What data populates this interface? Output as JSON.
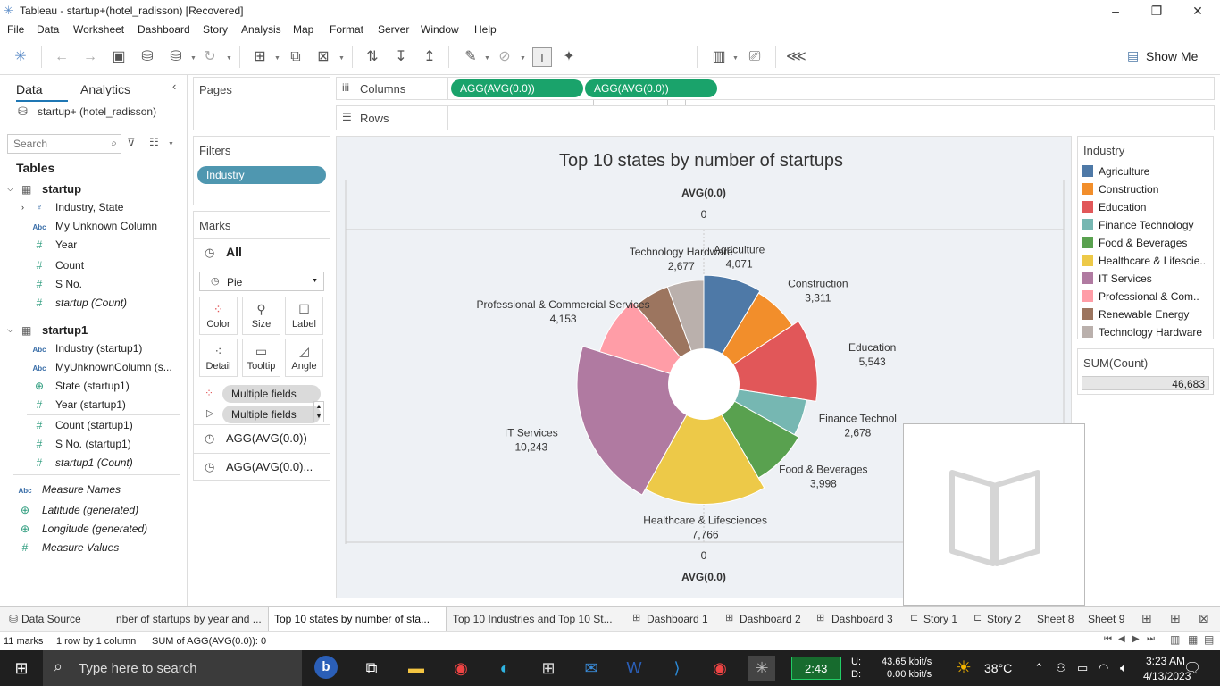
{
  "window": {
    "title": "Tableau - startup+(hotel_radisson) [Recovered]",
    "minimize": "–",
    "restore": "❐",
    "close": "✕"
  },
  "menu": [
    "File",
    "Data",
    "Worksheet",
    "Dashboard",
    "Story",
    "Analysis",
    "Map",
    "Format",
    "Server",
    "Window",
    "Help"
  ],
  "toolbar": {
    "view_mode": "Entire View",
    "show_me": "Show Me"
  },
  "data_pane": {
    "tab_data": "Data",
    "tab_analytics": "Analytics",
    "datasource": "startup+ (hotel_radisson)",
    "search_placeholder": "Search",
    "tables_label": "Tables",
    "table1": {
      "name": "startup",
      "fields": [
        {
          "type": "hier",
          "label": "Industry, State"
        },
        {
          "type": "abc",
          "label": "My Unknown Column"
        },
        {
          "type": "hash",
          "label": "Year"
        },
        {
          "type": "hash",
          "label": "Count"
        },
        {
          "type": "hash",
          "label": "S No."
        },
        {
          "type": "hash",
          "label": "startup (Count)"
        }
      ]
    },
    "table2": {
      "name": "startup1",
      "fields": [
        {
          "type": "abc",
          "label": "Industry (startup1)"
        },
        {
          "type": "abc",
          "label": "MyUnknownColumn (s..."
        },
        {
          "type": "globe",
          "label": "State (startup1)"
        },
        {
          "type": "hash",
          "label": "Year (startup1)"
        },
        {
          "type": "hash",
          "label": "Count (startup1)"
        },
        {
          "type": "hash",
          "label": "S No. (startup1)"
        },
        {
          "type": "hash",
          "label": "startup1 (Count)"
        }
      ]
    },
    "extra_fields": [
      {
        "type": "abc",
        "label": "Measure Names"
      },
      {
        "type": "globe",
        "label": "Latitude (generated)"
      },
      {
        "type": "globe",
        "label": "Longitude (generated)"
      },
      {
        "type": "hash",
        "label": "Measure Values"
      }
    ]
  },
  "shelves": {
    "pages": "Pages",
    "columns": "Columns",
    "rows": "Rows",
    "column_pills": [
      "AGG(AVG(0.0))",
      "AGG(AVG(0.0))"
    ],
    "filters": "Filters",
    "filter_pill": "Industry"
  },
  "marks": {
    "title": "Marks",
    "all": "All",
    "mark_type": "Pie",
    "buttons": [
      "Color",
      "Size",
      "Label",
      "Detail",
      "Tooltip",
      "Angle"
    ],
    "pills": [
      "Multiple fields",
      "Multiple fields"
    ],
    "measures": [
      "AGG(AVG(0.0))",
      "AGG(AVG(0.0)..."
    ]
  },
  "legend": {
    "title": "Industry",
    "items": [
      {
        "label": "Agriculture",
        "color": "#4e79a7"
      },
      {
        "label": "Construction",
        "color": "#f28e2b"
      },
      {
        "label": "Education",
        "color": "#e15759"
      },
      {
        "label": "Finance Technology",
        "color": "#76b7b2"
      },
      {
        "label": "Food & Beverages",
        "color": "#59a14f"
      },
      {
        "label": "Healthcare & Lifescie..",
        "color": "#edc948"
      },
      {
        "label": "IT Services",
        "color": "#b07aa1"
      },
      {
        "label": "Professional & Com..",
        "color": "#ff9da7"
      },
      {
        "label": "Renewable Energy",
        "color": "#9c755f"
      },
      {
        "label": "Technology Hardware",
        "color": "#bab0ac"
      }
    ]
  },
  "sum_card": {
    "title": "SUM(Count)",
    "value": "46,683"
  },
  "chart_data": {
    "type": "pie",
    "title": "Top 10 states by number of startups",
    "axis_top_label": "AVG(0.0)",
    "axis_top_tick": "0",
    "axis_bottom_label": "AVG(0.0)",
    "axis_bottom_tick": "0",
    "slices": [
      {
        "label": "Agriculture",
        "value": 4071,
        "display": "4,071",
        "color": "#4e79a7"
      },
      {
        "label": "Construction",
        "value": 3311,
        "display": "3,311",
        "color": "#f28e2b"
      },
      {
        "label": "Education",
        "value": 5543,
        "display": "5,543",
        "color": "#e15759"
      },
      {
        "label": "Finance Technol",
        "value": 2678,
        "display": "2,678",
        "color": "#76b7b2"
      },
      {
        "label": "Food & Beverages",
        "value": 3998,
        "display": "3,998",
        "color": "#59a14f"
      },
      {
        "label": "Healthcare & Lifesciences",
        "value": 7766,
        "display": "7,766",
        "color": "#edc948"
      },
      {
        "label": "IT Services",
        "value": 10243,
        "display": "10,243",
        "color": "#b07aa1"
      },
      {
        "label": "Professional & Commercial Services",
        "value": 4153,
        "display": "4,153",
        "color": "#ff9da7"
      },
      {
        "label": "Renewable Energy",
        "value": 2677,
        "display": "",
        "color": "#9c755f"
      },
      {
        "label": "Technology Hardware",
        "value": 2677,
        "display": "2,677",
        "color": "#bab0ac"
      }
    ]
  },
  "sheet_tabs": {
    "datasource": "Data Source",
    "tabs": [
      "nber of startups by year and ...",
      "Top 10 states by number of sta...",
      "Top 10 Industries and Top 10 St...",
      "Dashboard 1",
      "Dashboard 2",
      "Dashboard 3",
      "Story 1",
      "Story 2",
      "Sheet 8",
      "Sheet 9"
    ]
  },
  "status": {
    "marks": "11 marks",
    "rows": "1 row by 1 column",
    "sum": "SUM of AGG(AVG(0.0)): 0"
  },
  "taskbar": {
    "search_placeholder": "Type here to search",
    "battery_time": "2:43",
    "net_up": "43.65 kbit/s",
    "net_down": "0.00 kbit/s",
    "net_u": "U:",
    "net_d": "D:",
    "temp": "38°C",
    "time": "3:23 AM",
    "date": "4/13/2023"
  }
}
